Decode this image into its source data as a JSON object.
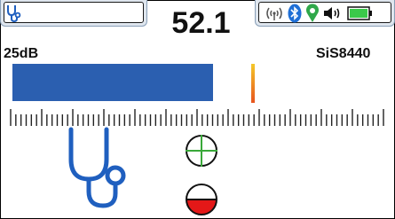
{
  "header": {
    "reading": "52.1",
    "reading_color": "#111111"
  },
  "status": {
    "gain_label": "25dB",
    "model_label": "SiS8440",
    "icons": [
      "stethoscope-mode-icon",
      "signal-broadcast-icon",
      "bluetooth-icon",
      "gps-location-icon",
      "speaker-volume-icon",
      "battery-icon"
    ],
    "bluetooth_color": "#1f6fd6",
    "gps_color": "#2fa84a",
    "battery_color": "#3ac94a"
  },
  "meter": {
    "level": 0.55,
    "peak": 0.655,
    "bar_color": "#2b5fb0"
  },
  "indicators": {
    "crosshair_color": "#3aa83a",
    "lower_fill_color": "#e41818",
    "lower_fill_fraction": 0.5
  }
}
